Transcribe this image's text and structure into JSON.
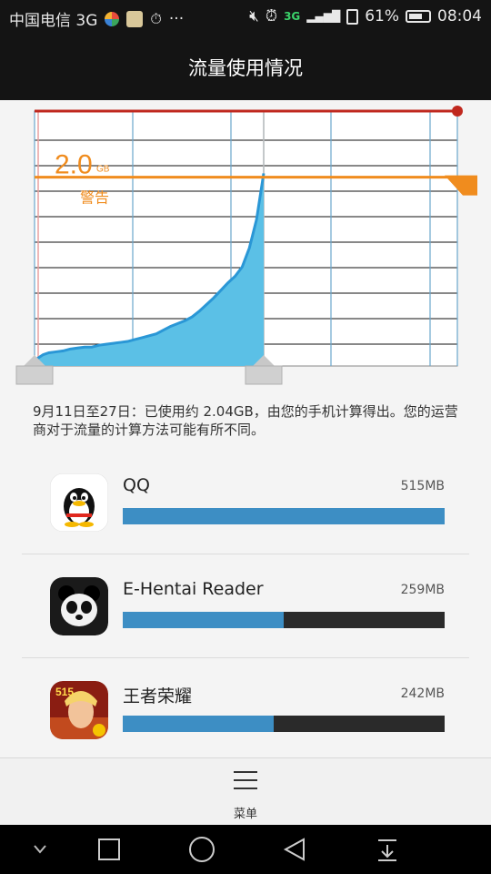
{
  "status_bar": {
    "carrier": "中国电信 3G",
    "network_badge": "3G",
    "battery": "61%",
    "time": "08:04",
    "icons": [
      "sync-icon",
      "app-badge-icon",
      "alarm-clock-icon",
      "more-icon",
      "mute-icon",
      "alarm-icon",
      "signal-icon",
      "sim-icon",
      "battery-icon"
    ]
  },
  "header": {
    "title": "流量使用情况"
  },
  "usage_chart": {
    "limit_value": "2.0",
    "limit_unit": "GB",
    "warning_label": "警告",
    "colors": {
      "limit_line": "#c0281e",
      "warning_line": "#f08c1e",
      "area": "#5bc0e6",
      "area_stroke": "#2a97d6",
      "grid": "#111111"
    }
  },
  "chart_data": {
    "type": "area",
    "title": "",
    "xlabel": "",
    "ylabel": "",
    "x": [
      0,
      0.2,
      0.6,
      1,
      1.5,
      2,
      2.5,
      3,
      3.5,
      4,
      4.5,
      5,
      5.5,
      6,
      6.5,
      7,
      7.5,
      8,
      8.5,
      9,
      9.5,
      10,
      10.5,
      11,
      11.5,
      12,
      12.5,
      13,
      13.5,
      14,
      14.5,
      15,
      15.5,
      16
    ],
    "values": [
      0.0,
      0.08,
      0.12,
      0.14,
      0.15,
      0.16,
      0.18,
      0.19,
      0.2,
      0.2,
      0.22,
      0.23,
      0.24,
      0.25,
      0.26,
      0.28,
      0.3,
      0.32,
      0.34,
      0.38,
      0.42,
      0.45,
      0.48,
      0.52,
      0.58,
      0.65,
      0.72,
      0.8,
      0.88,
      0.95,
      1.05,
      1.25,
      1.55,
      2.04
    ],
    "ylim": [
      0,
      2.7
    ],
    "warning_threshold": 2.0,
    "limit_threshold": 2.7,
    "grid": true
  },
  "summary": {
    "text": "9月11日至27日：已使用约 2.04GB，由您的手机计算得出。您的运营商对于流量的计算方法可能有所不同。"
  },
  "apps": [
    {
      "name": "QQ",
      "size": "515MB",
      "fraction": 1.0,
      "icon": "qq-penguin-icon"
    },
    {
      "name": "E-Hentai Reader",
      "size": "259MB",
      "fraction": 0.5,
      "icon": "panda-icon"
    },
    {
      "name": "王者荣耀",
      "size": "242MB",
      "fraction": 0.47,
      "icon": "game-hero-icon"
    }
  ],
  "menu": {
    "label": "菜单"
  },
  "nav": [
    "chevron-down-icon",
    "recent-apps-icon",
    "home-icon",
    "back-icon",
    "notification-pull-icon"
  ]
}
